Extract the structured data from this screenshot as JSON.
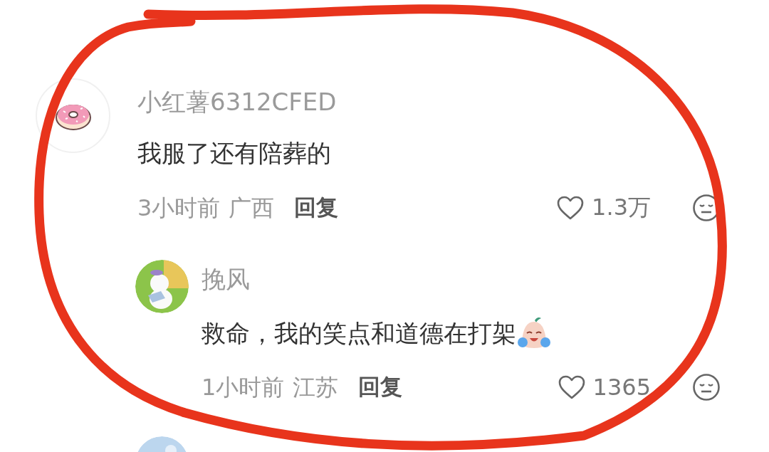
{
  "comment": {
    "author": "小红薯6312CFED",
    "text": "我服了还有陪葬的",
    "time": "3小时前",
    "location": "广西",
    "reply_label": "回复",
    "likes": "1.3万",
    "avatar": {
      "kind": "donut"
    }
  },
  "replies": [
    {
      "author": "挽风",
      "text": "救命，我的笑点和道德在打架",
      "has_sticker": true,
      "time": "1小时前",
      "location": "江苏",
      "reply_label": "回复",
      "likes": "1365"
    }
  ],
  "annotation": {
    "kind": "freehand-circle"
  }
}
